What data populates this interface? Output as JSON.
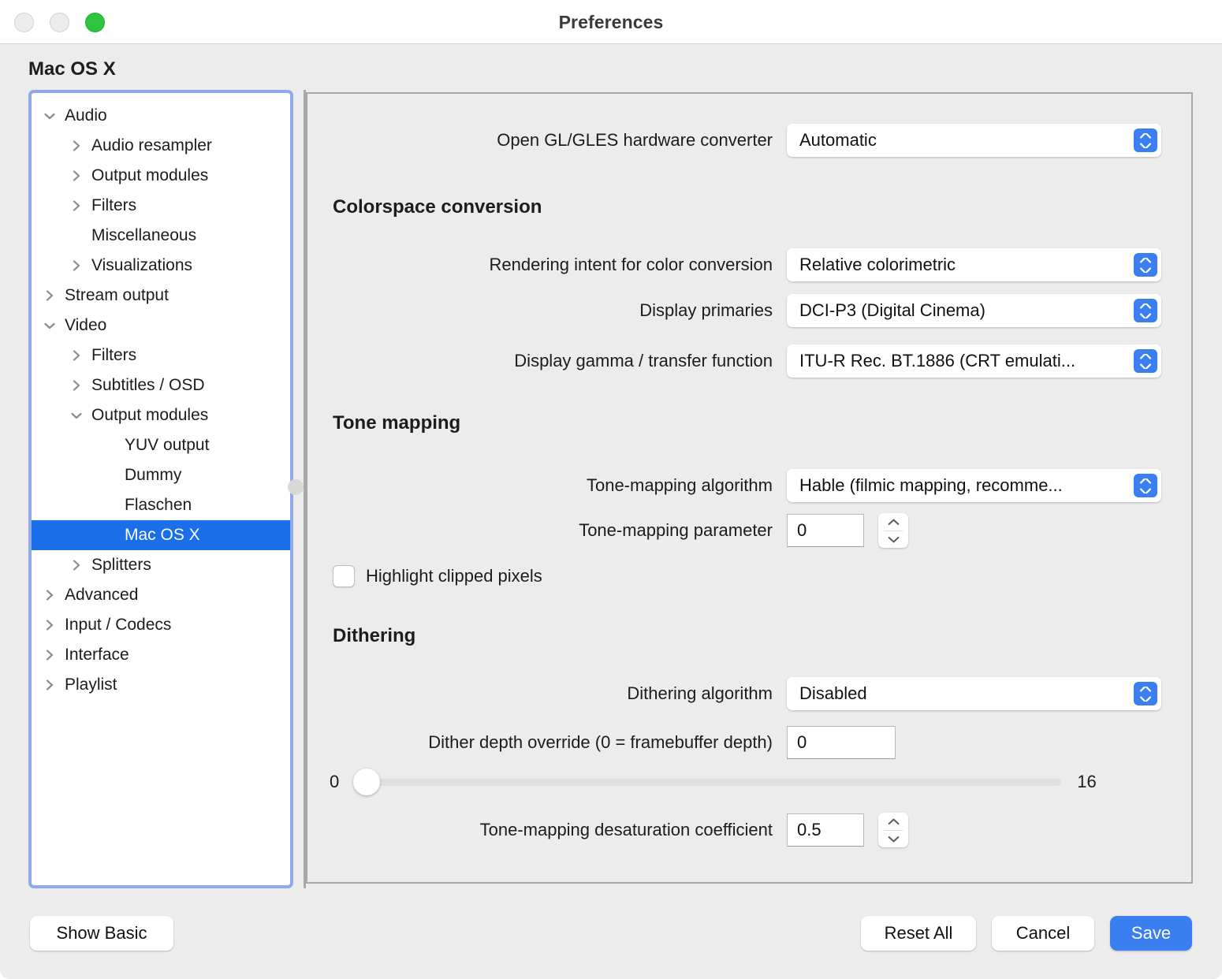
{
  "window": {
    "title": "Preferences",
    "traffic_lights": [
      "close-button",
      "minimize-button",
      "zoom-button"
    ],
    "accent_color": "#3b7ef0",
    "selection_color": "#1a6fe8"
  },
  "page_title": "Mac OS X",
  "sidebar": {
    "items": [
      {
        "label": "Audio",
        "level": 0,
        "chevron": "down",
        "selected": false
      },
      {
        "label": "Audio resampler",
        "level": 1,
        "chevron": "right",
        "selected": false
      },
      {
        "label": "Output modules",
        "level": 1,
        "chevron": "right",
        "selected": false
      },
      {
        "label": "Filters",
        "level": 1,
        "chevron": "right",
        "selected": false
      },
      {
        "label": "Miscellaneous",
        "level": 1,
        "chevron": "none",
        "selected": false
      },
      {
        "label": "Visualizations",
        "level": 1,
        "chevron": "right",
        "selected": false
      },
      {
        "label": "Stream output",
        "level": 0,
        "chevron": "right",
        "selected": false
      },
      {
        "label": "Video",
        "level": 0,
        "chevron": "down",
        "selected": false
      },
      {
        "label": "Filters",
        "level": 1,
        "chevron": "right",
        "selected": false
      },
      {
        "label": "Subtitles / OSD",
        "level": 1,
        "chevron": "right",
        "selected": false
      },
      {
        "label": "Output modules",
        "level": 1,
        "chevron": "down",
        "selected": false
      },
      {
        "label": "YUV output",
        "level": 2,
        "chevron": "none",
        "selected": false
      },
      {
        "label": "Dummy",
        "level": 2,
        "chevron": "none",
        "selected": false
      },
      {
        "label": "Flaschen",
        "level": 2,
        "chevron": "none",
        "selected": false
      },
      {
        "label": "Mac OS X",
        "level": 2,
        "chevron": "none",
        "selected": true
      },
      {
        "label": "Splitters",
        "level": 1,
        "chevron": "right",
        "selected": false
      },
      {
        "label": "Advanced",
        "level": 0,
        "chevron": "right",
        "selected": false
      },
      {
        "label": "Input / Codecs",
        "level": 0,
        "chevron": "right",
        "selected": false
      },
      {
        "label": "Interface",
        "level": 0,
        "chevron": "right",
        "selected": false
      },
      {
        "label": "Playlist",
        "level": 0,
        "chevron": "right",
        "selected": false
      }
    ]
  },
  "panel": {
    "opengl_converter": {
      "label": "Open GL/GLES hardware converter",
      "value": "Automatic"
    },
    "colorspace": {
      "heading": "Colorspace conversion",
      "rendering_intent": {
        "label": "Rendering intent for color conversion",
        "value": "Relative colorimetric"
      },
      "display_primaries": {
        "label": "Display primaries",
        "value": "DCI-P3 (Digital Cinema)"
      },
      "display_gamma": {
        "label": "Display gamma / transfer function",
        "value": "ITU-R Rec. BT.1886 (CRT emulati..."
      }
    },
    "tone_mapping": {
      "heading": "Tone mapping",
      "algorithm": {
        "label": "Tone-mapping algorithm",
        "value": "Hable (filmic mapping, recomme..."
      },
      "parameter": {
        "label": "Tone-mapping parameter",
        "value": "0"
      },
      "highlight_clipped": {
        "label": "Highlight clipped pixels",
        "checked": false
      }
    },
    "dithering": {
      "heading": "Dithering",
      "algorithm": {
        "label": "Dithering algorithm",
        "value": "Disabled"
      },
      "depth_override": {
        "label": "Dither depth override (0 = framebuffer depth)",
        "value": "0"
      },
      "depth_slider": {
        "min_label": "0",
        "max_label": "16",
        "value": 0
      },
      "desaturation": {
        "label": "Tone-mapping desaturation coefficient",
        "value": "0.5"
      }
    }
  },
  "footer": {
    "show_basic": "Show Basic",
    "reset_all": "Reset All",
    "cancel": "Cancel",
    "save": "Save"
  }
}
